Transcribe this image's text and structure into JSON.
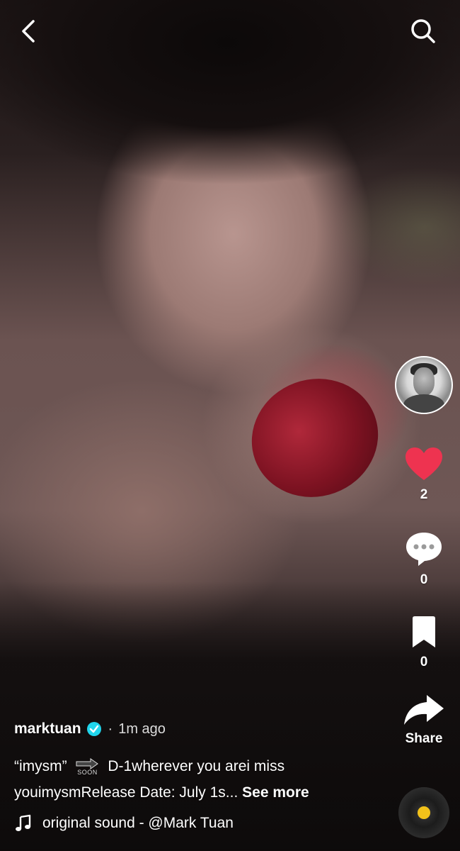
{
  "top_bar": {
    "back_icon": "chevron-left-icon",
    "search_icon": "search-icon"
  },
  "side_rail": {
    "likes": "2",
    "comments": "0",
    "saves": "0",
    "share_label": "Share",
    "like_color": "#ee3350"
  },
  "post": {
    "username": "marktuan",
    "separator": "·",
    "time": "1m ago",
    "caption_part1": "“imysm”",
    "soon_label": "SOON",
    "caption_part2": " D-1wherever you arei miss youimysmRelease Date: July 1s...",
    "see_more": " See more",
    "sound": "original sound - @Mark Tuan"
  },
  "colors": {
    "verified": "#20d5ec",
    "disc_center": "#f2c21a"
  }
}
